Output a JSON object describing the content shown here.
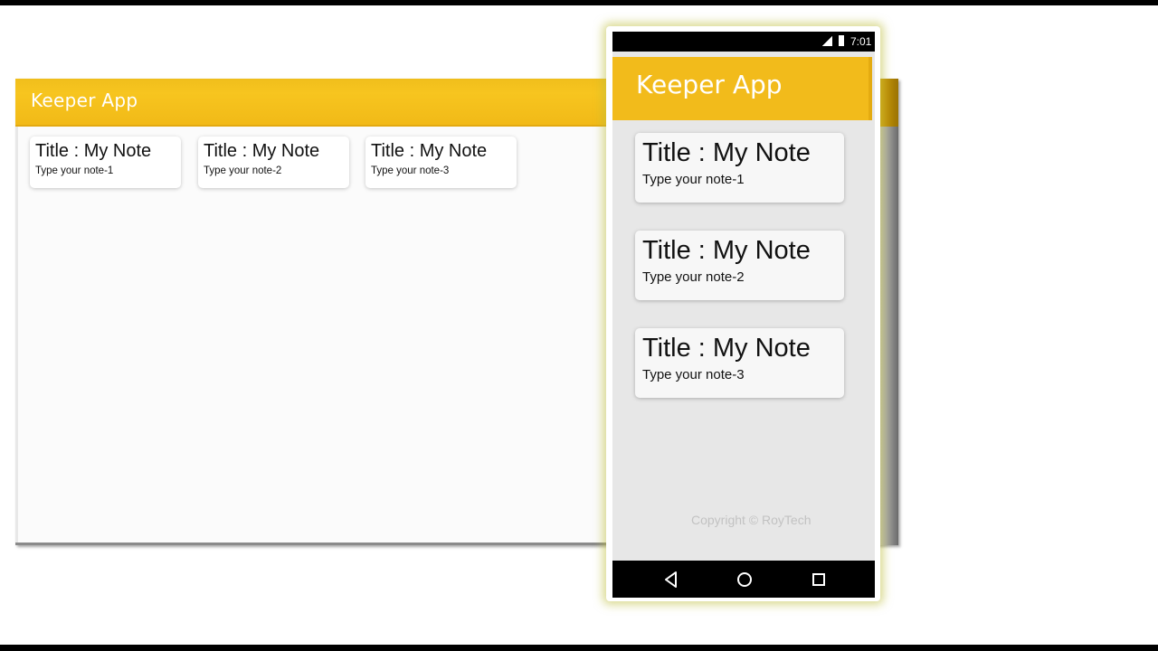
{
  "desktop": {
    "title": "Keeper App",
    "notes": [
      {
        "title": "Title : My Note",
        "content": "Type your note-1"
      },
      {
        "title": "Title : My Note",
        "content": "Type your note-2"
      },
      {
        "title": "Title : My Note",
        "content": "Type your note-3"
      }
    ]
  },
  "phone": {
    "status": {
      "time": "7:01",
      "icons": [
        "signal-icon",
        "battery-icon"
      ]
    },
    "title": "Keeper App",
    "notes": [
      {
        "title": "Title : My Note",
        "content": "Type your note-1"
      },
      {
        "title": "Title : My Note",
        "content": "Type your note-2"
      },
      {
        "title": "Title : My Note",
        "content": "Type your note-3"
      }
    ],
    "footer": "Copyright © RoyTech",
    "nav": [
      "back-icon",
      "home-icon",
      "recents-icon"
    ]
  },
  "colors": {
    "header": "#f7c51f",
    "background": "#fbfbfb",
    "phone_bg": "#e7e7e7"
  }
}
